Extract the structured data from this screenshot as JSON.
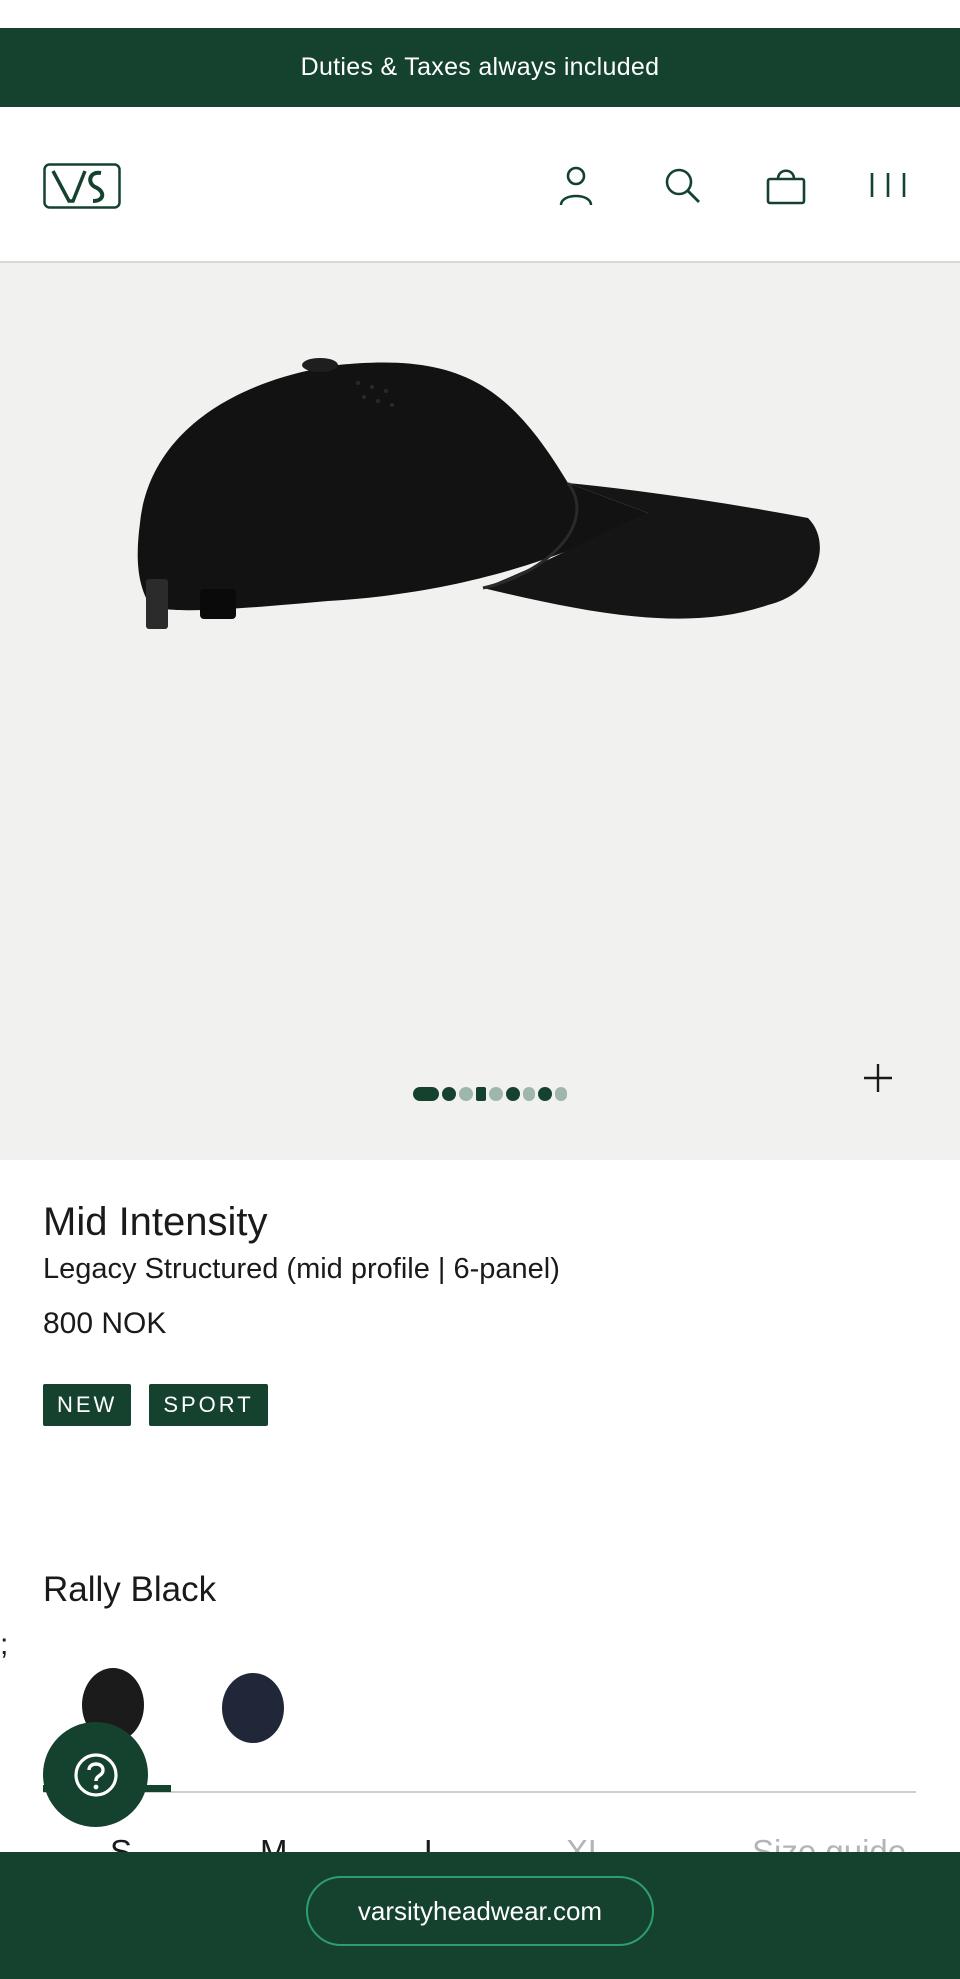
{
  "announcement": {
    "text": "Duties & Taxes always included"
  },
  "header": {
    "logo_text": "VS",
    "icons": [
      "account-icon",
      "search-icon",
      "bag-icon",
      "menu-icon"
    ]
  },
  "gallery": {
    "image": "black-cap-side-view",
    "dot_count": 9,
    "active_dots": [
      0,
      1,
      3,
      5,
      6
    ],
    "zoom_icon": "plus-icon"
  },
  "product": {
    "title": "Mid Intensity",
    "subtitle": "Legacy Structured (mid profile | 6-panel)",
    "price": "800 NOK",
    "badges": [
      "NEW",
      "SPORT"
    ]
  },
  "color": {
    "selected_name": "Rally Black",
    "stray_text": ";",
    "swatches": [
      "#1b1b1b",
      "#1f2738"
    ]
  },
  "sizes": [
    "S",
    "M",
    "L",
    "XL",
    "Size guide"
  ],
  "help": {
    "icon": "question-icon"
  },
  "footer": {
    "url": "varsityheadwear.com"
  },
  "colors": {
    "brand_green": "#15422f",
    "gallery_bg": "#f1f1ef",
    "pill_border": "#2f9e6c"
  }
}
